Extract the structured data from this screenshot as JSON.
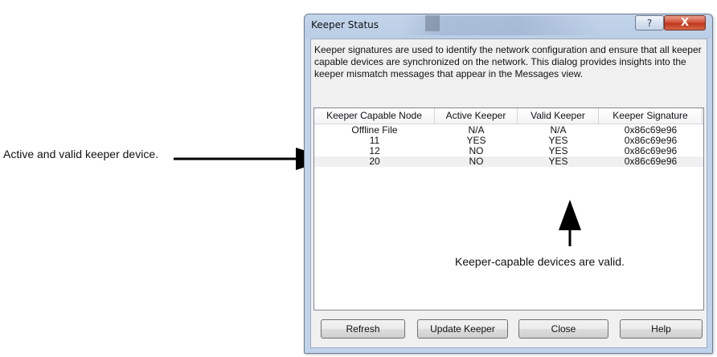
{
  "callouts": {
    "left_text": "Active and valid keeper device.",
    "bottom_text": "Keeper-capable devices are valid."
  },
  "dialog": {
    "title": "Keeper Status",
    "help_glyph": "?",
    "close_glyph": "X",
    "description": "Keeper signatures are used to identify the network configuration and ensure that all keeper capable devices are synchronized on the network. This dialog provides insights into the keeper mismatch messages that appear in the Messages view.",
    "columns": [
      "Keeper Capable Node",
      "Active Keeper",
      "Valid Keeper",
      "Keeper Signature"
    ],
    "rows": [
      [
        "Offline File",
        "N/A",
        "N/A",
        "0x86c69e96"
      ],
      [
        "11",
        "YES",
        "YES",
        "0x86c69e96"
      ],
      [
        "12",
        "NO",
        "YES",
        "0x86c69e96"
      ],
      [
        "20",
        "NO",
        "YES",
        "0x86c69e96"
      ]
    ],
    "buttons": {
      "refresh": "Refresh",
      "update_keeper": "Update Keeper",
      "close": "Close",
      "help": "Help"
    }
  },
  "colors": {
    "frame": "#bfd3ea",
    "close_button": "#c1361a",
    "arrow": "#000000"
  }
}
